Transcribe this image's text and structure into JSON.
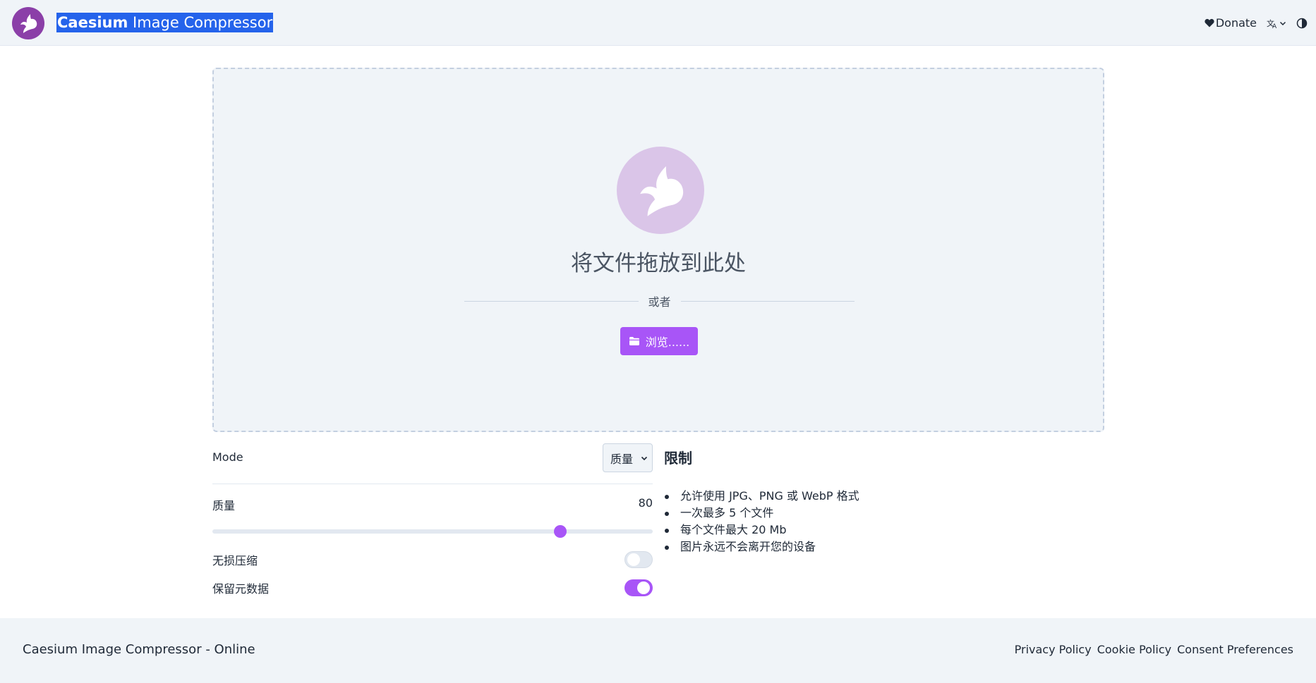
{
  "header": {
    "brand_bold": "Caesium",
    "brand_rest": " Image Compressor",
    "donate_label": "Donate",
    "logo_icon": "caesium-bird-logo",
    "language_icon": "translate-icon",
    "theme_icon": "contrast-icon"
  },
  "dropzone": {
    "title": "将文件拖放到此处",
    "or_text": "或者",
    "browse_label": "浏览......",
    "browse_icon": "folder-icon"
  },
  "settings": {
    "mode_label": "Mode",
    "mode_selected": "质量",
    "quality_label": "质量",
    "quality_value": "80",
    "quality_fraction": 0.79,
    "lossless_label": "无损压缩",
    "lossless_on": false,
    "keep_metadata_label": "保留元数据",
    "keep_metadata_on": true
  },
  "limits": {
    "title": "限制",
    "items": [
      "允许使用 JPG、PNG 或 WebP 格式",
      "一次最多 5 个文件",
      "每个文件最大 20 Mb",
      "图片永远不会离开您的设备"
    ]
  },
  "footer": {
    "app_name": "Caesium Image Compressor - Online",
    "links": [
      "Privacy Policy",
      "Cookie Policy",
      "Consent Preferences"
    ]
  },
  "colors": {
    "accent": "#a855f7",
    "header_bg": "#f0f4f8",
    "logo_bg": "#8b3fa8",
    "selection_bg": "#2563eb"
  }
}
